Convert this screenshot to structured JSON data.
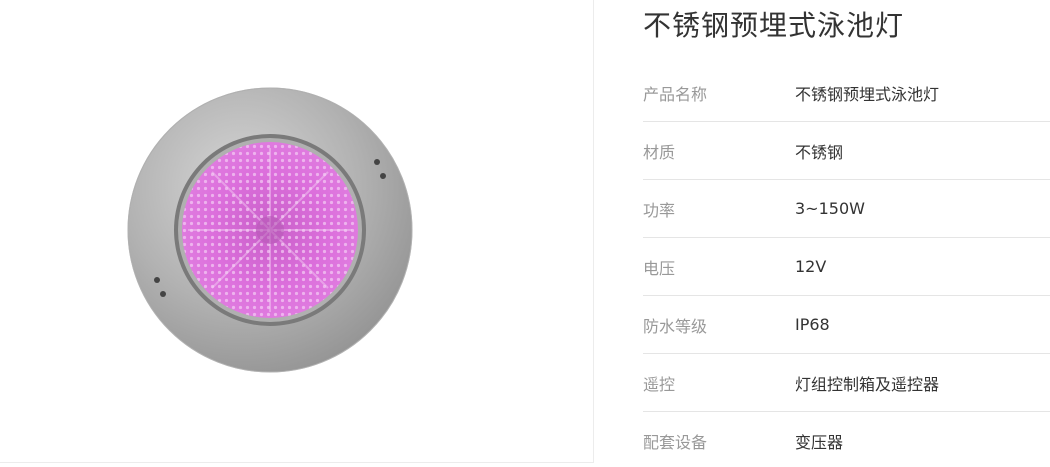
{
  "product": {
    "image_alt": "不锈钢预埋式泳池灯",
    "title": "不锈钢预埋式泳池灯"
  },
  "specs": [
    {
      "label": "产品名称",
      "value": "不锈钢预埋式泳池灯"
    },
    {
      "label": "材质",
      "value": "不锈钢"
    },
    {
      "label": "功率",
      "value": "3~150W"
    },
    {
      "label": "电压",
      "value": "12V"
    },
    {
      "label": "防水等级",
      "value": "IP68"
    },
    {
      "label": "遥控",
      "value": "灯组控制箱及遥控器"
    },
    {
      "label": "配套设备",
      "value": "变压器"
    }
  ],
  "colors": {
    "led_glow": "#d86ad8",
    "ring": "#a9a9a9"
  }
}
